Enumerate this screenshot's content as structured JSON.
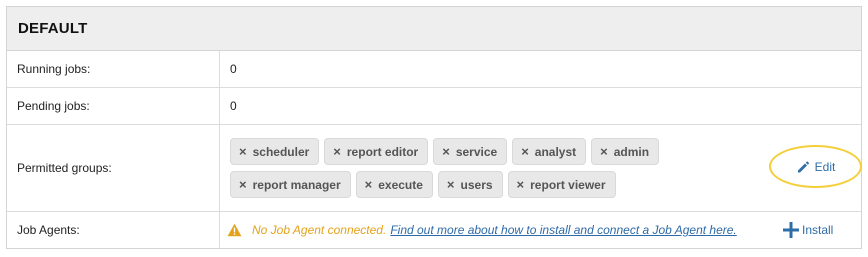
{
  "panel": {
    "title": "DEFAULT"
  },
  "rows": {
    "running": {
      "label": "Running jobs:",
      "value": "0"
    },
    "pending": {
      "label": "Pending jobs:",
      "value": "0"
    },
    "groups": {
      "label": "Permitted groups:",
      "tags": [
        "scheduler",
        "report editor",
        "service",
        "analyst",
        "admin",
        "report manager",
        "execute",
        "users",
        "report viewer"
      ],
      "remove_glyph": "×",
      "edit_label": "Edit",
      "edit_icon": "pencil-icon"
    },
    "agents": {
      "label": "Job Agents:",
      "warning_icon": "warning-triangle-icon",
      "warning_text": "No Job Agent connected.",
      "link_text": "Find out more about how to install and connect a Job Agent here.",
      "install_label": "Install",
      "install_icon": "plus-icon"
    }
  },
  "colors": {
    "header_bg": "#eeeeee",
    "tag_bg": "#e8e8e8",
    "accent_blue": "#2f6da8",
    "warning": "#e3a21a",
    "highlight": "#f4cf3a"
  }
}
